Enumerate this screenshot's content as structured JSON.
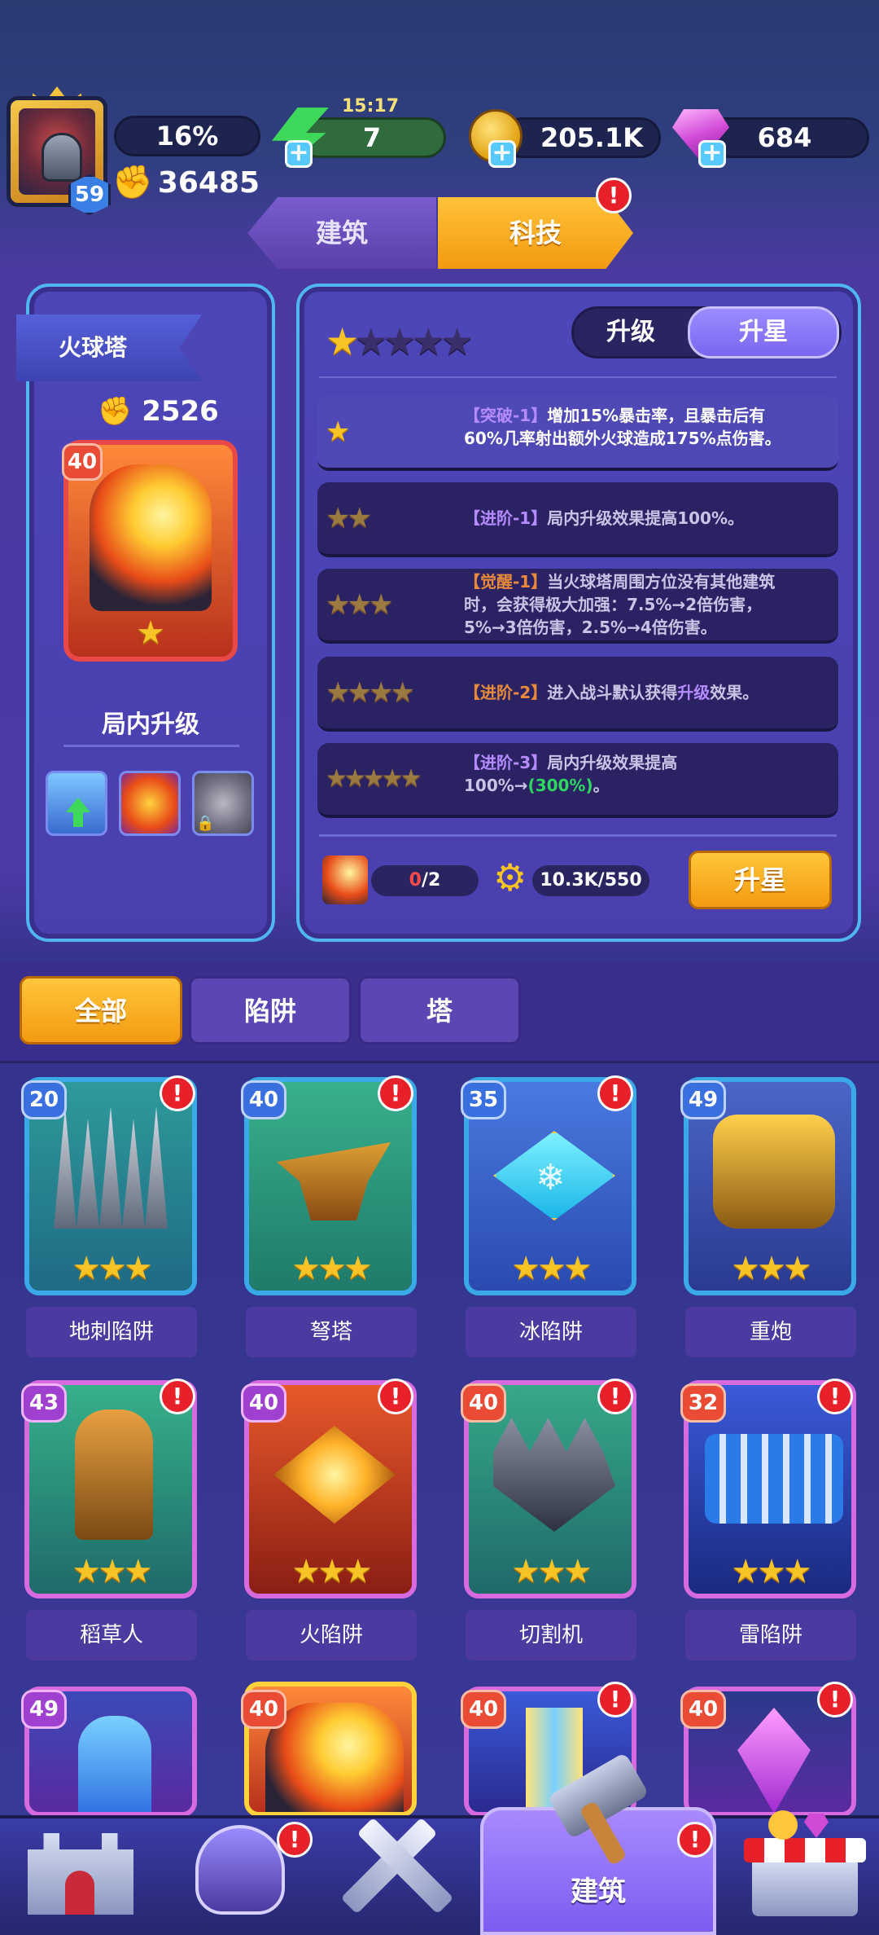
{
  "top_bar": {
    "player_level": "59",
    "progress_text": "16%",
    "power": "36485",
    "energy_timer": "15:17",
    "energy": "7",
    "gold": "205.1K",
    "gems": "684",
    "plus_symbol": "+"
  },
  "main_tabs": [
    {
      "label": "建筑",
      "active": false
    },
    {
      "label": "科技",
      "active": true,
      "alert": "!"
    }
  ],
  "detail": {
    "name": "火球塔",
    "power": "2526",
    "level": "40",
    "subtitle": "局内升级"
  },
  "star_panel": {
    "stars_filled": 1,
    "stars_total": 5,
    "toggle_upgrade": "升级",
    "toggle_star": "升星",
    "abilities": [
      {
        "stars": "★",
        "tag": "【突破-1】",
        "tag_color": "purple",
        "line1": "增加15%暴击率，且暴击后有",
        "line2": "60%几率射出额外火球造成175%点伤害。",
        "active": true
      },
      {
        "stars": "★★",
        "tag": "【进阶-1】",
        "tag_color": "purple",
        "line1": "局内升级效果提高100%。",
        "line2": "",
        "active": false
      },
      {
        "stars": "★★★",
        "tag": "【觉醒-1】",
        "tag_color": "orange",
        "line1": "当火球塔周围方位没有其他建筑",
        "line2": "时，会获得极大加强：7.5%→2倍伤害，",
        "line3": "5%→3倍伤害，2.5%→4倍伤害。",
        "active": false
      },
      {
        "stars": "★★★★",
        "tag": "【进阶-2】",
        "tag_color": "orange",
        "line1_a": "进入战斗默认获得",
        "line1_hl": "升级",
        "line1_b": "效果。",
        "active": false
      },
      {
        "stars": "★★★★★",
        "tag": "【进阶-3】",
        "tag_color": "purple",
        "line1": "局内升级效果提高",
        "line2_a": "100%→",
        "line2_hl": "(300%)",
        "line2_b": "。",
        "active": false
      }
    ],
    "shard_have": "0",
    "shard_need": "/2",
    "gears": "10.3K/550",
    "star_button": "升星"
  },
  "filters": [
    {
      "label": "全部",
      "active": true
    },
    {
      "label": "陷阱",
      "active": false
    },
    {
      "label": "塔",
      "active": false
    }
  ],
  "buildings": [
    {
      "name": "地刺陷阱",
      "level": "20",
      "alert": true,
      "stars": "★★★"
    },
    {
      "name": "弩塔",
      "level": "40",
      "alert": true,
      "stars": "★★★"
    },
    {
      "name": "冰陷阱",
      "level": "35",
      "alert": true,
      "stars": "★★★"
    },
    {
      "name": "重炮",
      "level": "49",
      "alert": false,
      "stars": "★★★"
    },
    {
      "name": "稻草人",
      "level": "43",
      "alert": true,
      "stars": "★★★"
    },
    {
      "name": "火陷阱",
      "level": "40",
      "alert": true,
      "stars": "★★★"
    },
    {
      "name": "切割机",
      "level": "40",
      "alert": true,
      "stars": "★★★"
    },
    {
      "name": "雷陷阱",
      "level": "32",
      "alert": true,
      "stars": "★★★"
    },
    {
      "name": "",
      "level": "49",
      "alert": false
    },
    {
      "name": "",
      "level": "40",
      "alert": false
    },
    {
      "name": "",
      "level": "40",
      "alert": true
    },
    {
      "name": "",
      "level": "40",
      "alert": true
    }
  ],
  "bottom_nav": {
    "active_label": "建筑",
    "items": [
      "castle-icon",
      "helmet-icon",
      "crossed-swords-icon",
      "hammer-icon",
      "shop-icon"
    ]
  },
  "colors": {
    "accent_orange": "#f39a10",
    "alert_red": "#e8202a",
    "panel_border": "#4fb6f0",
    "star_gold": "#f7c325"
  }
}
